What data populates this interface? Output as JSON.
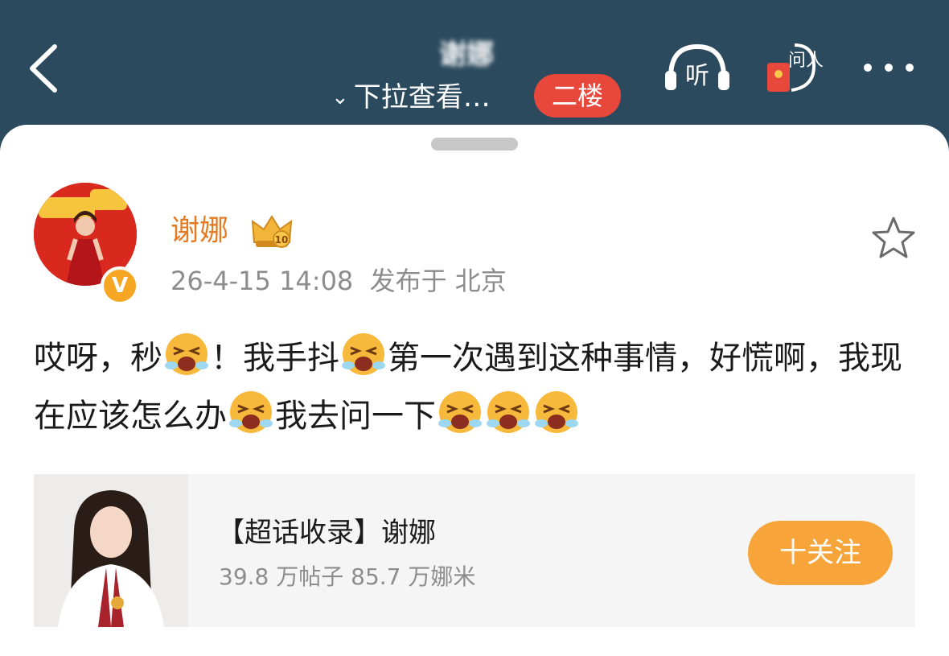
{
  "header": {
    "title": "谢娜",
    "pull_down": "下拉查看…",
    "pull_chevron": "⌄",
    "floor_button": "二楼",
    "listen_label": "听",
    "ask_label": "问人",
    "background": "#2b4a5e"
  },
  "post": {
    "username": "谢娜",
    "verified_mark": "V",
    "timestamp": "26-4-15 14:08",
    "location": "发布于 北京",
    "text_segments": [
      "哎呀，秒",
      "！我手抖",
      "第一次遇到这种事情，好慌啊，我现在应该怎么办",
      "我去问一下",
      "",
      "",
      ""
    ],
    "emoji_name": "crying-face-emoji",
    "accent": "#e37b24"
  },
  "topic": {
    "title": "【超话收录】谢娜",
    "posts": "39.8 万帖子",
    "fans": "85.7 万娜米",
    "follow_button": "十关注",
    "follow_color": "#f7a53b"
  }
}
